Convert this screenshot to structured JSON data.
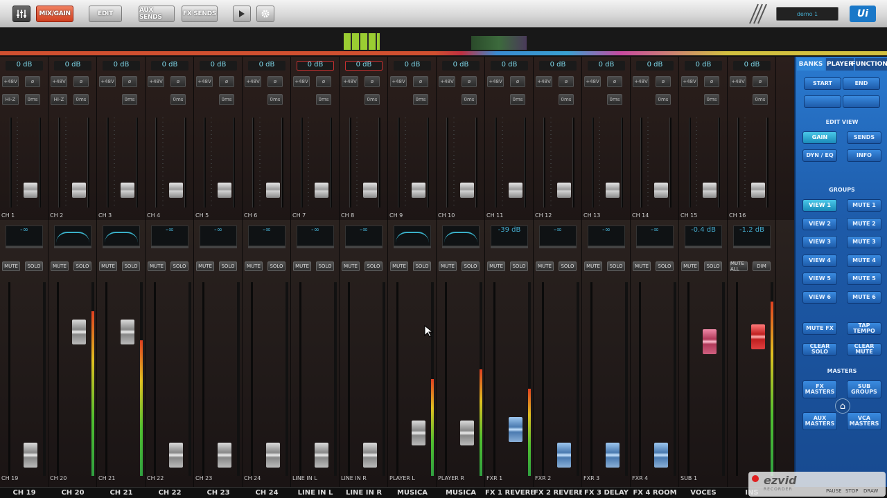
{
  "toolbar": {
    "mix_gain": "MIX/GAIN",
    "edit": "EDIT",
    "aux_sends": "AUX SENDS",
    "fx_sends": "FX SENDS",
    "play_icon": "play-icon",
    "settings_icon": "gear-icon",
    "show": "demo 1",
    "logo": "Ui"
  },
  "colors": {
    "accent": "#1d5aa8",
    "mute_red": "#c02020",
    "gain_cyan": "#7fd6e8"
  },
  "upper": {
    "channels": [
      {
        "gain": "0 dB",
        "phantom": "+48V",
        "hiz": "HI-Z",
        "delay": "0ms",
        "name": "CH 1",
        "gain_red": false
      },
      {
        "gain": "0 dB",
        "phantom": "+48V",
        "hiz": "HI-Z",
        "delay": "0ms",
        "name": "CH 2",
        "gain_red": false
      },
      {
        "gain": "0 dB",
        "phantom": "+48V",
        "hiz": "",
        "delay": "0ms",
        "name": "CH 3",
        "gain_red": false
      },
      {
        "gain": "0 dB",
        "phantom": "+48V",
        "hiz": "",
        "delay": "0ms",
        "name": "CH 4",
        "gain_red": false
      },
      {
        "gain": "0 dB",
        "phantom": "+48V",
        "hiz": "",
        "delay": "0ms",
        "name": "CH 5",
        "gain_red": false
      },
      {
        "gain": "0 dB",
        "phantom": "+48V",
        "hiz": "",
        "delay": "0ms",
        "name": "CH 6",
        "gain_red": false
      },
      {
        "gain": "0 dB",
        "phantom": "+48V",
        "hiz": "",
        "delay": "0ms",
        "name": "CH 7",
        "gain_red": true
      },
      {
        "gain": "0 dB",
        "phantom": "+48V",
        "hiz": "",
        "delay": "0ms",
        "name": "CH 8",
        "gain_red": true
      },
      {
        "gain": "0 dB",
        "phantom": "+48V",
        "hiz": "",
        "delay": "0ms",
        "name": "CH 9",
        "gain_red": false
      },
      {
        "gain": "0 dB",
        "phantom": "+48V",
        "hiz": "",
        "delay": "0ms",
        "name": "CH 10",
        "gain_red": false
      },
      {
        "gain": "0 dB",
        "phantom": "+48V",
        "hiz": "",
        "delay": "0ms",
        "name": "CH 11",
        "gain_red": false
      },
      {
        "gain": "0 dB",
        "phantom": "+48V",
        "hiz": "",
        "delay": "0ms",
        "name": "CH 12",
        "gain_red": false
      },
      {
        "gain": "0 dB",
        "phantom": "+48V",
        "hiz": "",
        "delay": "0ms",
        "name": "CH 13",
        "gain_red": false
      },
      {
        "gain": "0 dB",
        "phantom": "+48V",
        "hiz": "",
        "delay": "0ms",
        "name": "CH 14",
        "gain_red": false
      },
      {
        "gain": "0 dB",
        "phantom": "+48V",
        "hiz": "",
        "delay": "0ms",
        "name": "CH 15",
        "gain_red": false
      },
      {
        "gain": "0 dB",
        "phantom": "+48V",
        "hiz": "",
        "delay": "0ms",
        "name": "CH 16",
        "gain_red": false
      }
    ]
  },
  "lower": {
    "channels": [
      {
        "send": "-∞",
        "mute": "MUTE",
        "solo": "SOLO",
        "short": "CH 19",
        "name": "CH 19",
        "level": 0.05,
        "meter": 0,
        "cap": "grey"
      },
      {
        "send": "",
        "mute": "MUTE",
        "solo": "SOLO",
        "short": "CH 20",
        "name": "CH 20",
        "level": 0.78,
        "meter": 0.85,
        "cap": "grey"
      },
      {
        "send": "",
        "mute": "MUTE",
        "solo": "SOLO",
        "short": "CH 21",
        "name": "CH 21",
        "level": 0.78,
        "meter": 0.7,
        "cap": "grey"
      },
      {
        "send": "-∞",
        "mute": "MUTE",
        "solo": "SOLO",
        "short": "CH 22",
        "name": "CH 22",
        "level": 0.05,
        "meter": 0,
        "cap": "grey"
      },
      {
        "send": "-∞",
        "mute": "MUTE",
        "solo": "SOLO",
        "short": "CH 23",
        "name": "CH 23",
        "level": 0.05,
        "meter": 0,
        "cap": "grey"
      },
      {
        "send": "-∞",
        "mute": "MUTE",
        "solo": "SOLO",
        "short": "CH 24",
        "name": "CH 24",
        "level": 0.05,
        "meter": 0,
        "cap": "grey"
      },
      {
        "send": "-∞",
        "mute": "MUTE",
        "solo": "SOLO",
        "short": "LINE IN L",
        "name": "LINE IN L",
        "level": 0.05,
        "meter": 0,
        "cap": "grey"
      },
      {
        "send": "-∞",
        "mute": "MUTE",
        "solo": "SOLO",
        "short": "LINE IN R",
        "name": "LINE IN R",
        "level": 0.05,
        "meter": 0,
        "cap": "grey"
      },
      {
        "send": "",
        "mute": "MUTE",
        "solo": "SOLO",
        "short": "PLAYER L",
        "name": "MUSICA",
        "level": 0.18,
        "meter": 0.5,
        "cap": "grey"
      },
      {
        "send": "",
        "mute": "MUTE",
        "solo": "SOLO",
        "short": "PLAYER R",
        "name": "MUSICA",
        "level": 0.18,
        "meter": 0.55,
        "cap": "grey"
      },
      {
        "send": "-39 dB",
        "mute": "MUTE",
        "solo": "SOLO",
        "short": "FXR 1",
        "name": "FX 1 REVERB",
        "level": 0.2,
        "meter": 0.45,
        "cap": "blue"
      },
      {
        "send": "-∞",
        "mute": "MUTE",
        "solo": "SOLO",
        "short": "FXR 2",
        "name": "FX 2 REVERB",
        "level": 0.05,
        "meter": 0,
        "cap": "blue"
      },
      {
        "send": "-∞",
        "mute": "MUTE",
        "solo": "SOLO",
        "short": "FXR 3",
        "name": "FX 3 DELAY",
        "level": 0.05,
        "meter": 0,
        "cap": "blue"
      },
      {
        "send": "-∞",
        "mute": "MUTE",
        "solo": "SOLO",
        "short": "FXR 4",
        "name": "FX 4 ROOM",
        "level": 0.05,
        "meter": 0,
        "cap": "blue"
      },
      {
        "send": "-0.4 dB",
        "mute": "MUTE",
        "solo": "SOLO",
        "short": "SUB 1",
        "name": "VOCES",
        "level": 0.72,
        "meter": 0,
        "cap": "pink"
      },
      {
        "send": "-1.2 dB",
        "mute": "MUTE ALL",
        "solo": "DIM",
        "short": "",
        "name": "INS",
        "level": 0.75,
        "meter": 0.9,
        "cap": "red"
      }
    ]
  },
  "side": {
    "tabs": [
      "BANKS",
      "PLAYER",
      "FUNCTIONS"
    ],
    "start": "START",
    "end": "END",
    "edit_view": "EDIT VIEW",
    "gain": "GAIN",
    "sends": "SENDS",
    "dyn_eq": "DYN / EQ",
    "info": "INFO",
    "groups": "GROUPS",
    "views": [
      "VIEW 1",
      "VIEW 2",
      "VIEW 3",
      "VIEW 4",
      "VIEW 5",
      "VIEW 6"
    ],
    "mutes": [
      "MUTE 1",
      "MUTE 2",
      "MUTE 3",
      "MUTE 4",
      "MUTE 5",
      "MUTE 6"
    ],
    "mute_fx": "MUTE FX",
    "tap_tempo": "TAP TEMPO",
    "clear_solo": "CLEAR SOLO",
    "clear_mute": "CLEAR MUTE",
    "masters": "MASTERS",
    "fx_masters": "FX MASTERS",
    "sub_groups": "SUB GROUPS",
    "aux_masters": "AUX MASTERS",
    "vca_masters": "VCA MASTERS"
  },
  "recorder": {
    "brand": "ezvid",
    "sub": "RECORDER",
    "pause": "PAUSE",
    "stop": "STOP",
    "draw": "DRAW"
  }
}
